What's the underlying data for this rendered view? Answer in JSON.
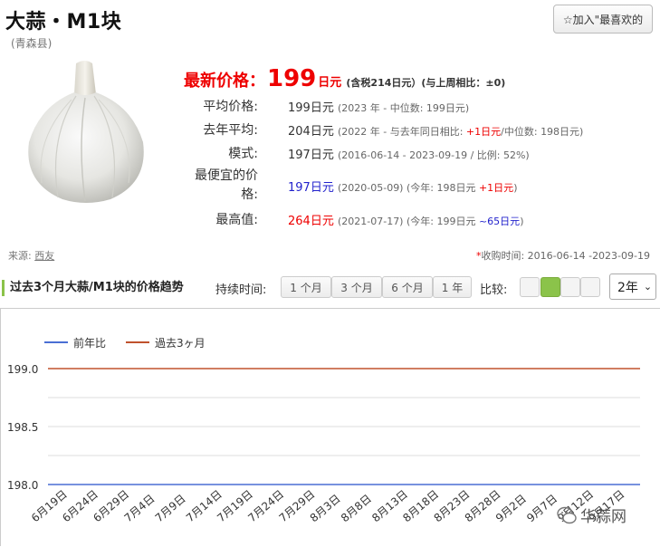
{
  "header": {
    "title": "大蒜・M1块",
    "subtitle": "(青森县)",
    "fav_button": "☆加入\"最喜欢的"
  },
  "price": {
    "latest_label": "最新价格：",
    "latest_value": "199",
    "latest_unit": "日元",
    "latest_note": "(含税214日元）(与上周相比：±0)",
    "rows": [
      {
        "label": "平均价格:",
        "value": "199日元",
        "note": "(2023 年 - 中位数: 199日元)"
      },
      {
        "label": "去年平均:",
        "value": "204日元",
        "note_a": "(2022 年 - 与去年同日相比: ",
        "note_red": "+1日元",
        "note_b": "/中位数: ",
        "note_c": "198日元)"
      },
      {
        "label": "模式:",
        "value": "197日元",
        "note": "(2016-06-14 - 2023-09-19 / 比例: 52%)"
      },
      {
        "label": "最便宜的价格:",
        "value": "197日元",
        "note_a": "(2020-05-09) (今年: 198日元 ",
        "note_red": "+1日元",
        "note_b": ")"
      },
      {
        "label": "最高值:",
        "value": "264日元",
        "note_a": "(2021-07-17) (今年: 199日元 ",
        "note_blue": "~65日元",
        "note_b": ")"
      }
    ]
  },
  "source": {
    "label": "来源:",
    "link": "西友"
  },
  "collect_time": {
    "star": "*",
    "text": "收购时间: 2016-06-14 -2023-09-19"
  },
  "controls": {
    "section_title": "过去3个月大蒜/M1块的价格趋势",
    "duration_label": "持续时间:",
    "tabs": [
      "1 个月",
      "3 个月",
      "6 个月",
      "1 年"
    ],
    "compare_label": "比较:",
    "year_select": "2年"
  },
  "chart_data": {
    "type": "line",
    "series": [
      {
        "name": "前年比",
        "color": "#4a6fd4",
        "values": [
          198.0,
          198.0,
          198.0,
          198.0,
          198.0,
          198.0,
          198.0,
          198.0,
          198.0,
          198.0,
          198.0,
          198.0,
          198.0,
          198.0,
          198.0,
          198.0,
          198.0,
          198.0,
          198.0,
          198.0
        ]
      },
      {
        "name": "過去3ヶ月",
        "color": "#c0522d",
        "values": [
          199.0,
          199.0,
          199.0,
          199.0,
          199.0,
          199.0,
          199.0,
          199.0,
          199.0,
          199.0,
          199.0,
          199.0,
          199.0,
          199.0,
          199.0,
          199.0,
          199.0,
          199.0,
          199.0,
          199.0
        ]
      }
    ],
    "categories": [
      "6月19日",
      "6月24日",
      "6月29日",
      "7月4日",
      "7月9日",
      "7月14日",
      "7月19日",
      "7月24日",
      "7月29日",
      "8月3日",
      "8月8日",
      "8月13日",
      "8月18日",
      "8月23日",
      "8月28日",
      "9月2日",
      "9月7日",
      "9月12日",
      "9月17日"
    ],
    "yticks": [
      "199.0",
      "198.5",
      "198.0"
    ],
    "ylim": [
      198.0,
      199.0
    ],
    "grid": true,
    "legend": "top-left"
  },
  "watermark": "华蒜网"
}
